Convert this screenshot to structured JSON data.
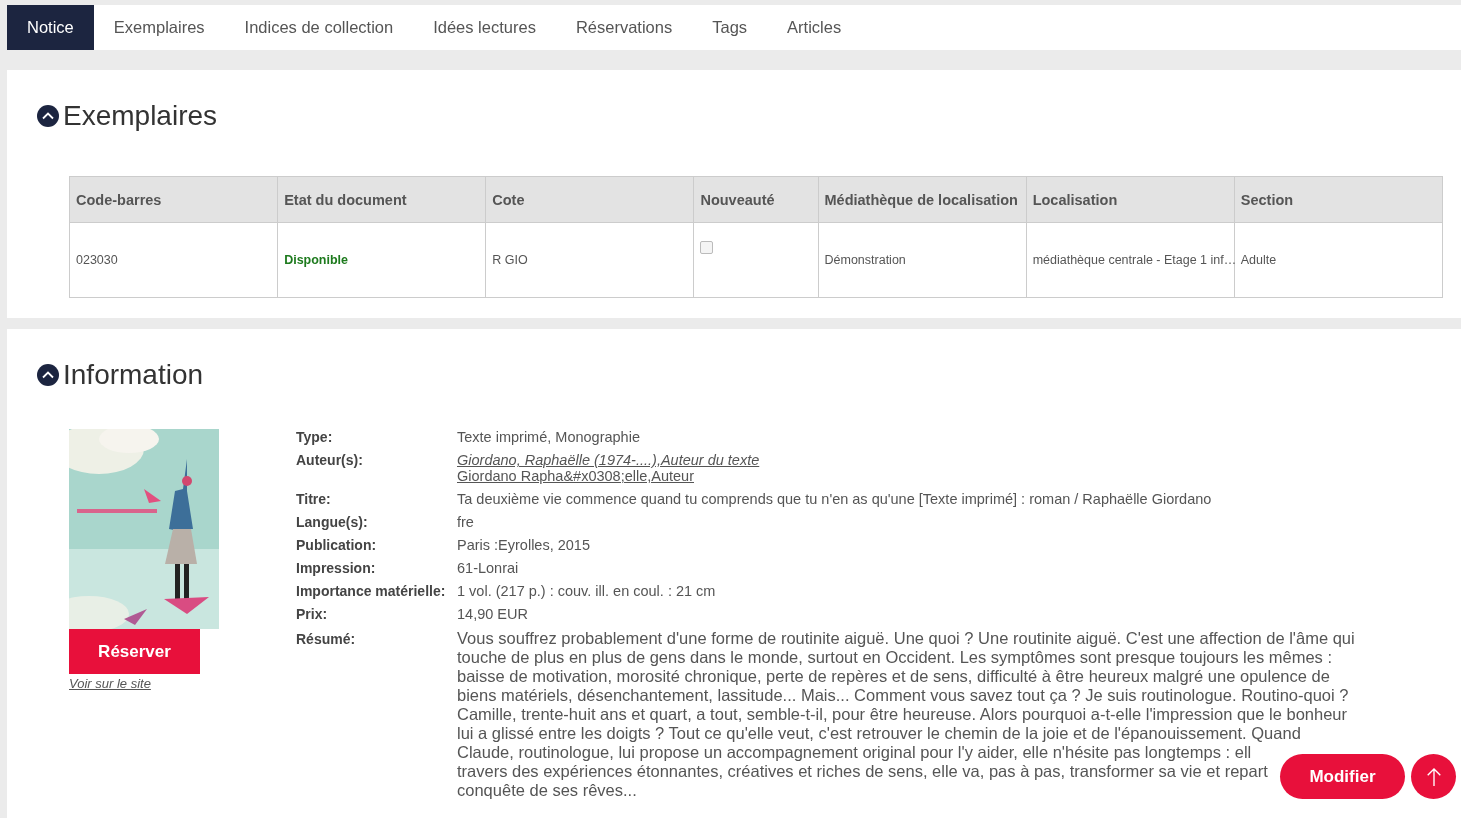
{
  "tabs": [
    {
      "label": "Notice",
      "selected": true
    },
    {
      "label": "Exemplaires",
      "selected": false
    },
    {
      "label": "Indices de collection",
      "selected": false
    },
    {
      "label": "Idées lectures",
      "selected": false
    },
    {
      "label": "Réservations",
      "selected": false
    },
    {
      "label": "Tags",
      "selected": false
    },
    {
      "label": "Articles",
      "selected": false
    }
  ],
  "exemplaires": {
    "title": "Exemplaires",
    "expanded": true,
    "table": {
      "columns": [
        "Code-barres",
        "Etat du document",
        "Cote",
        "Nouveauté",
        "Médiathèque de localisation",
        "Localisation",
        "Section"
      ],
      "rows": [
        {
          "code_barres": "023030",
          "etat": "Disponible",
          "cote": "R GIO",
          "nouveaute_checked": false,
          "mediatheque": "Démonstration",
          "localisation": "médiathèque centrale - Etage 1 inf…",
          "section": "Adulte"
        }
      ]
    }
  },
  "information": {
    "title": "Information",
    "expanded": true,
    "reserve_button": "Réserver",
    "site_link": "Voir sur le site",
    "fields": [
      {
        "label": "Type:",
        "value": "Texte imprimé, Monographie"
      },
      {
        "label": "Auteur(s):",
        "links": [
          "Giordano, Raphaëlle (1974-....),Auteur du texte",
          "Giordano Rapha&#x0308;elle,Auteur"
        ]
      },
      {
        "label": "Titre:",
        "value": "Ta deuxième vie commence quand tu comprends que tu n'en as qu'une [Texte imprimé] : roman / Raphaëlle Giordano"
      },
      {
        "label": "Langue(s):",
        "value": "fre"
      },
      {
        "label": "Publication:",
        "value": "Paris :Eyrolles, 2015"
      },
      {
        "label": "Impression:",
        "value": "61-Lonrai"
      },
      {
        "label": "Importance matérielle:",
        "value": "1 vol. (217 p.) : couv. ill. en coul. : 21 cm"
      },
      {
        "label": "Prix:",
        "value": "14,90 EUR"
      },
      {
        "label": "Résumé:",
        "lines": [
          "Vous souffrez probablement d'une forme de routinite aiguë. Une quoi ? Une routinite aiguë. C'est une affection de l'âme qui",
          "touche de plus en plus de gens dans le monde, surtout en Occident. Les symptômes sont presque toujours les mêmes :",
          "baisse de motivation, morosité chronique, perte de repères et de sens, difficulté à être heureux malgré une opulence de",
          "biens matériels, désenchantement, lassitude... Mais... Comment vous savez tout ça ? Je suis routinologue. Routino-quoi ?",
          "Camille, trente-huit ans et quart, a tout, semble-t-il, pour être heureuse. Alors pourquoi a-t-elle l'impression que le bonheur",
          "lui a glissé entre les doigts ? Tout ce qu'elle veut, c'est retrouver le chemin de la joie et de l'épanouissement. Quand",
          "Claude, routinologue, lui propose un accompagnement original pour l'y aider, elle n'hésite pas longtemps : ell",
          "travers des expériences étonnantes, créatives et riches de sens, elle va, pas à pas, transformer sa vie et repart",
          "conquête de ses rêves..."
        ]
      }
    ]
  },
  "floating": {
    "edit_button": "Modifier"
  }
}
